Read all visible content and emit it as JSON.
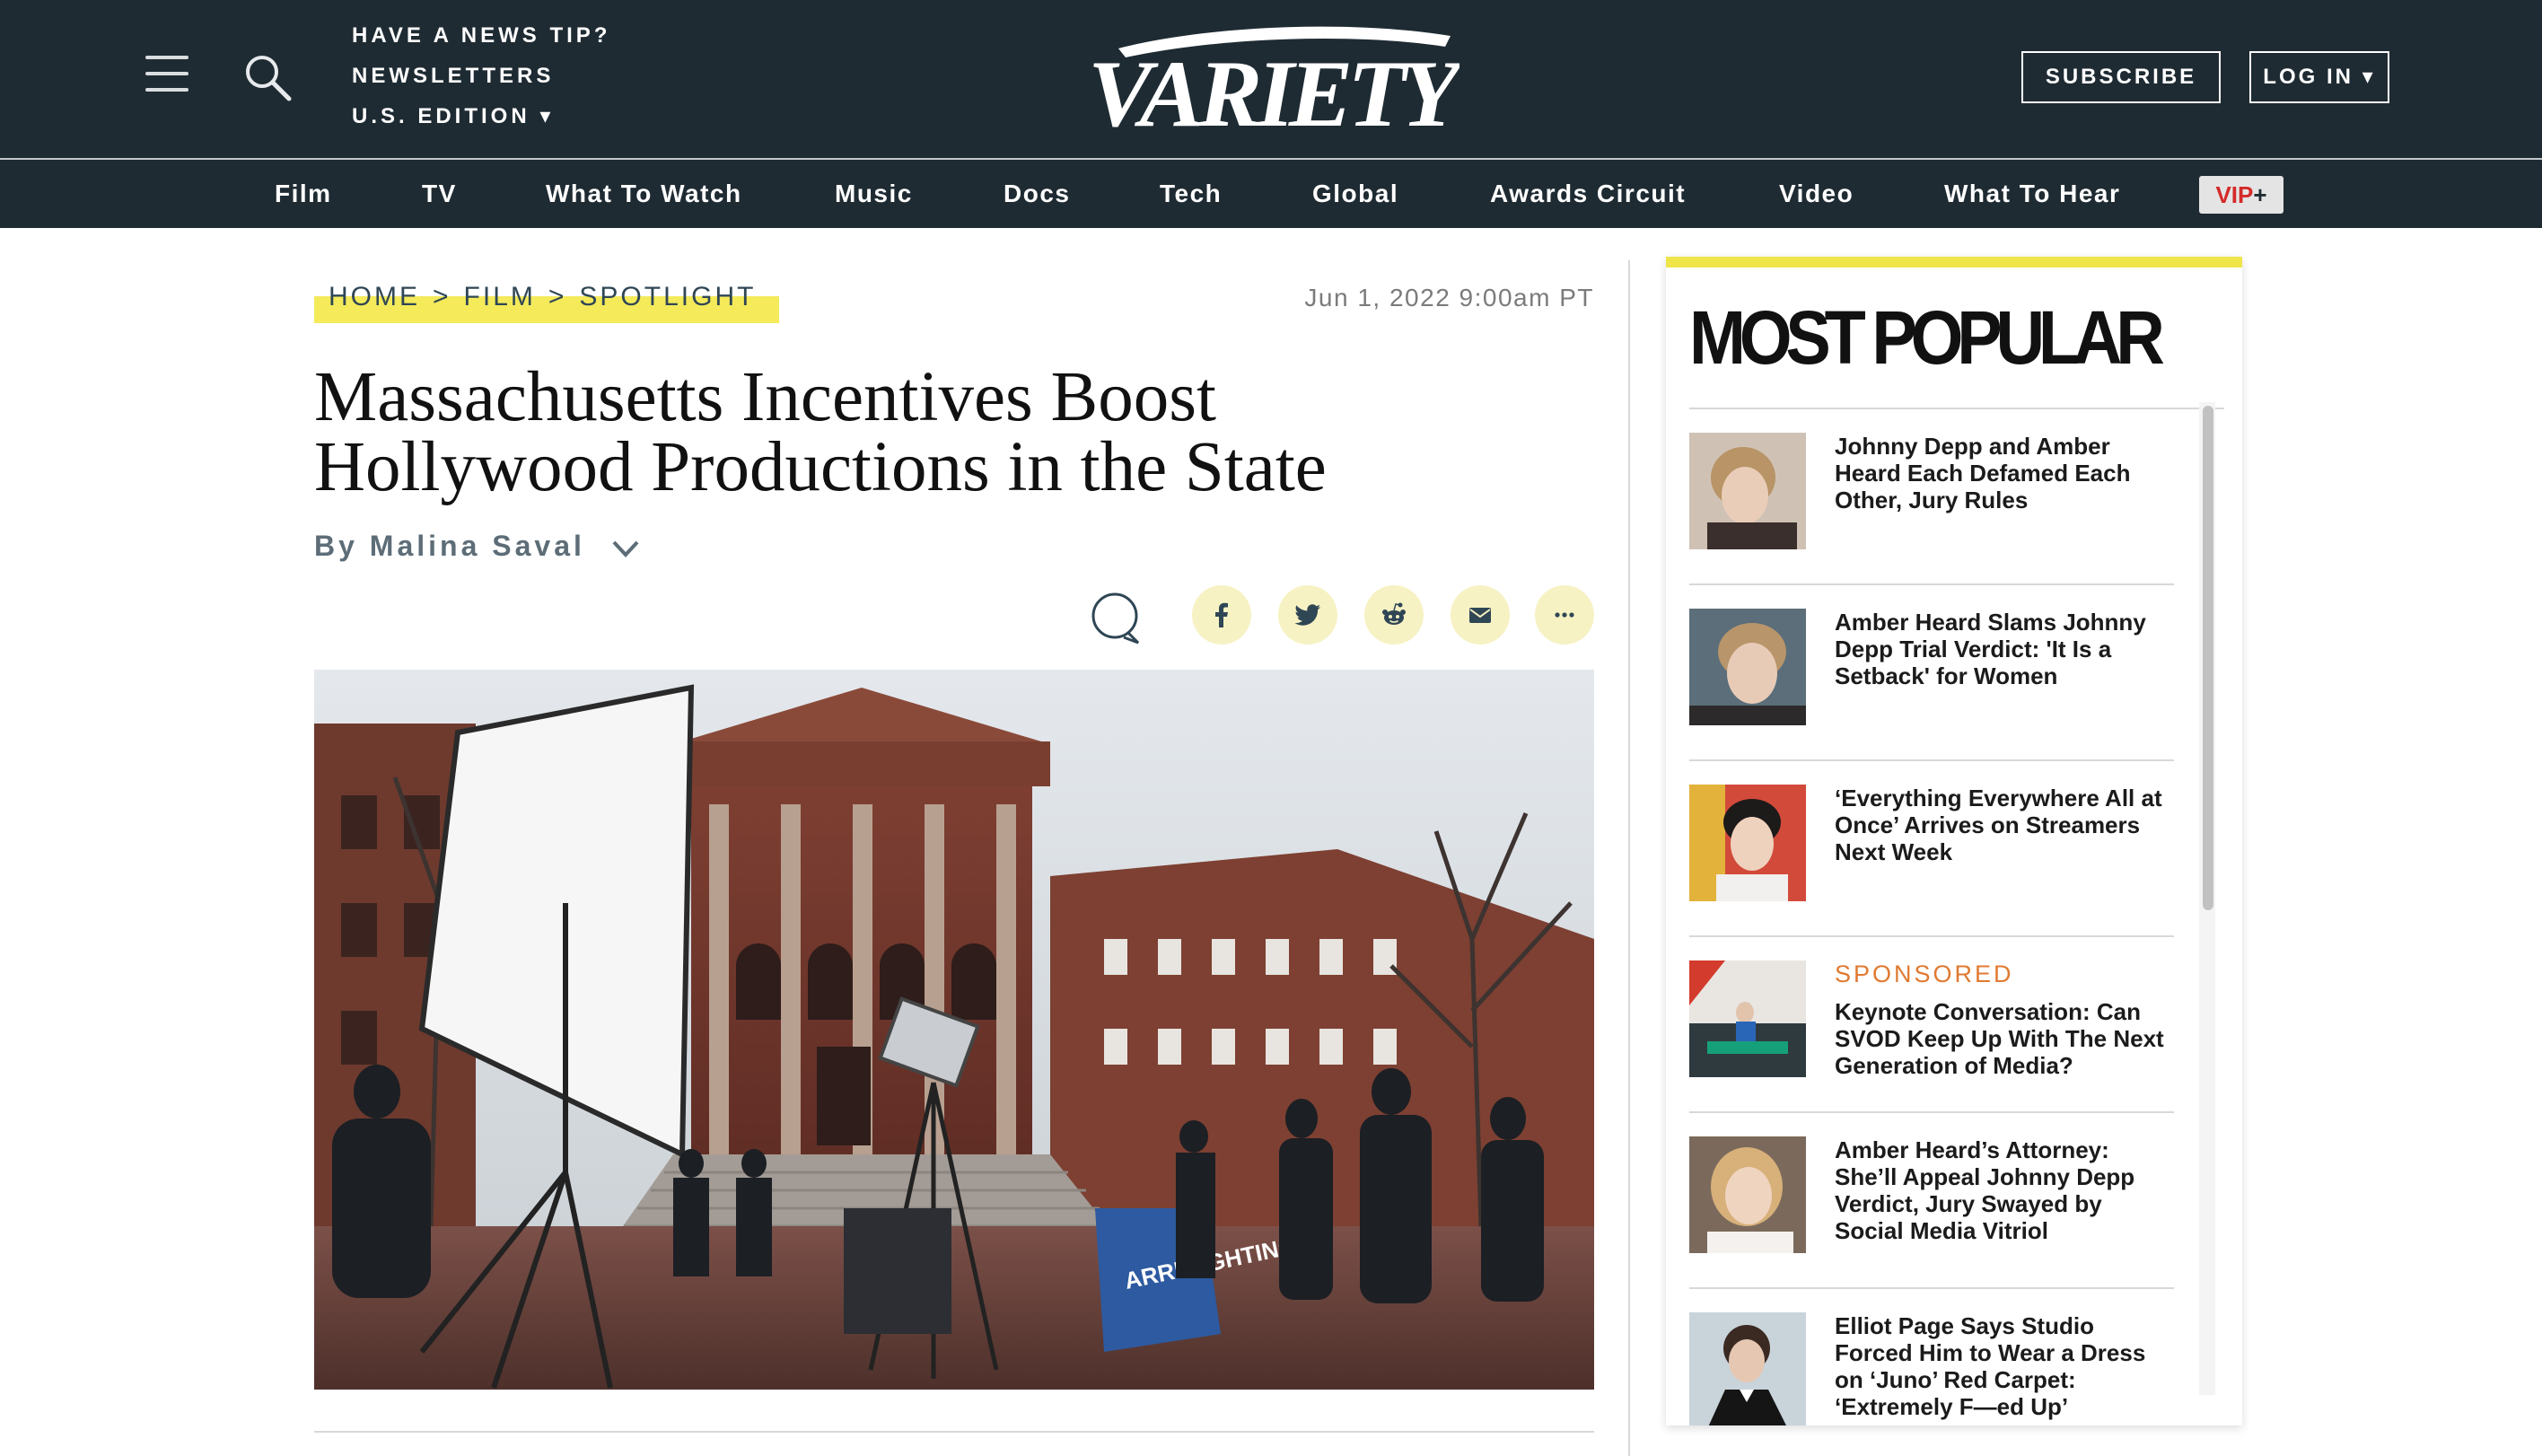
{
  "header": {
    "top_links": [
      "HAVE A NEWS TIP?",
      "NEWSLETTERS",
      "U.S. EDITION ▾"
    ],
    "logo_text": "VARIETY",
    "subscribe_label": "SUBSCRIBE",
    "login_label": "LOG IN ▾"
  },
  "nav": {
    "items": [
      "Film",
      "TV",
      "What To Watch",
      "Music",
      "Docs",
      "Tech",
      "Global",
      "Awards Circuit",
      "Video",
      "What To Hear"
    ],
    "vip_label": "VIP",
    "vip_plus": "+"
  },
  "article": {
    "breadcrumb": [
      "HOME",
      "FILM",
      "SPOTLIGHT"
    ],
    "breadcrumb_sep": ">",
    "date": "Jun 1, 2022 9:00am PT",
    "headline": "Massachusetts Incentives Boost Hollywood Productions in the State",
    "byline": "By Malina Saval",
    "share_buttons": [
      "facebook-icon",
      "twitter-icon",
      "reddit-icon",
      "email-icon",
      "more-icon"
    ],
    "hero_image_text": "ARRI LIGHTING"
  },
  "most_popular": {
    "title": "MOST POPULAR",
    "sponsored_label": "SPONSORED",
    "items": [
      {
        "headline": "Johnny Depp and Amber Heard Each Defamed Each Other, Jury Rules"
      },
      {
        "headline": "Amber Heard Slams Johnny Depp Trial Verdict: 'It Is a Setback' for Women"
      },
      {
        "headline": "‘Everything Everywhere All at Once’ Arrives on Streamers Next Week"
      },
      {
        "headline": "Keynote Conversation: Can SVOD Keep Up With The Next Generation of Media?",
        "sponsored": true
      },
      {
        "headline": "Amber Heard’s Attorney: She’ll Appeal Johnny Depp Verdict, Jury Swayed by Social Media Vitriol"
      },
      {
        "headline": "Elliot Page Says Studio Forced Him to Wear a Dress on ‘Juno’ Red Carpet: ‘Extremely F—ed Up’"
      }
    ]
  },
  "colors": {
    "header_bg": "#1f2b33",
    "highlight_yellow": "#f4ea5a",
    "sponsored_orange": "#e07a31",
    "share_button_bg": "#f7f2c4"
  }
}
